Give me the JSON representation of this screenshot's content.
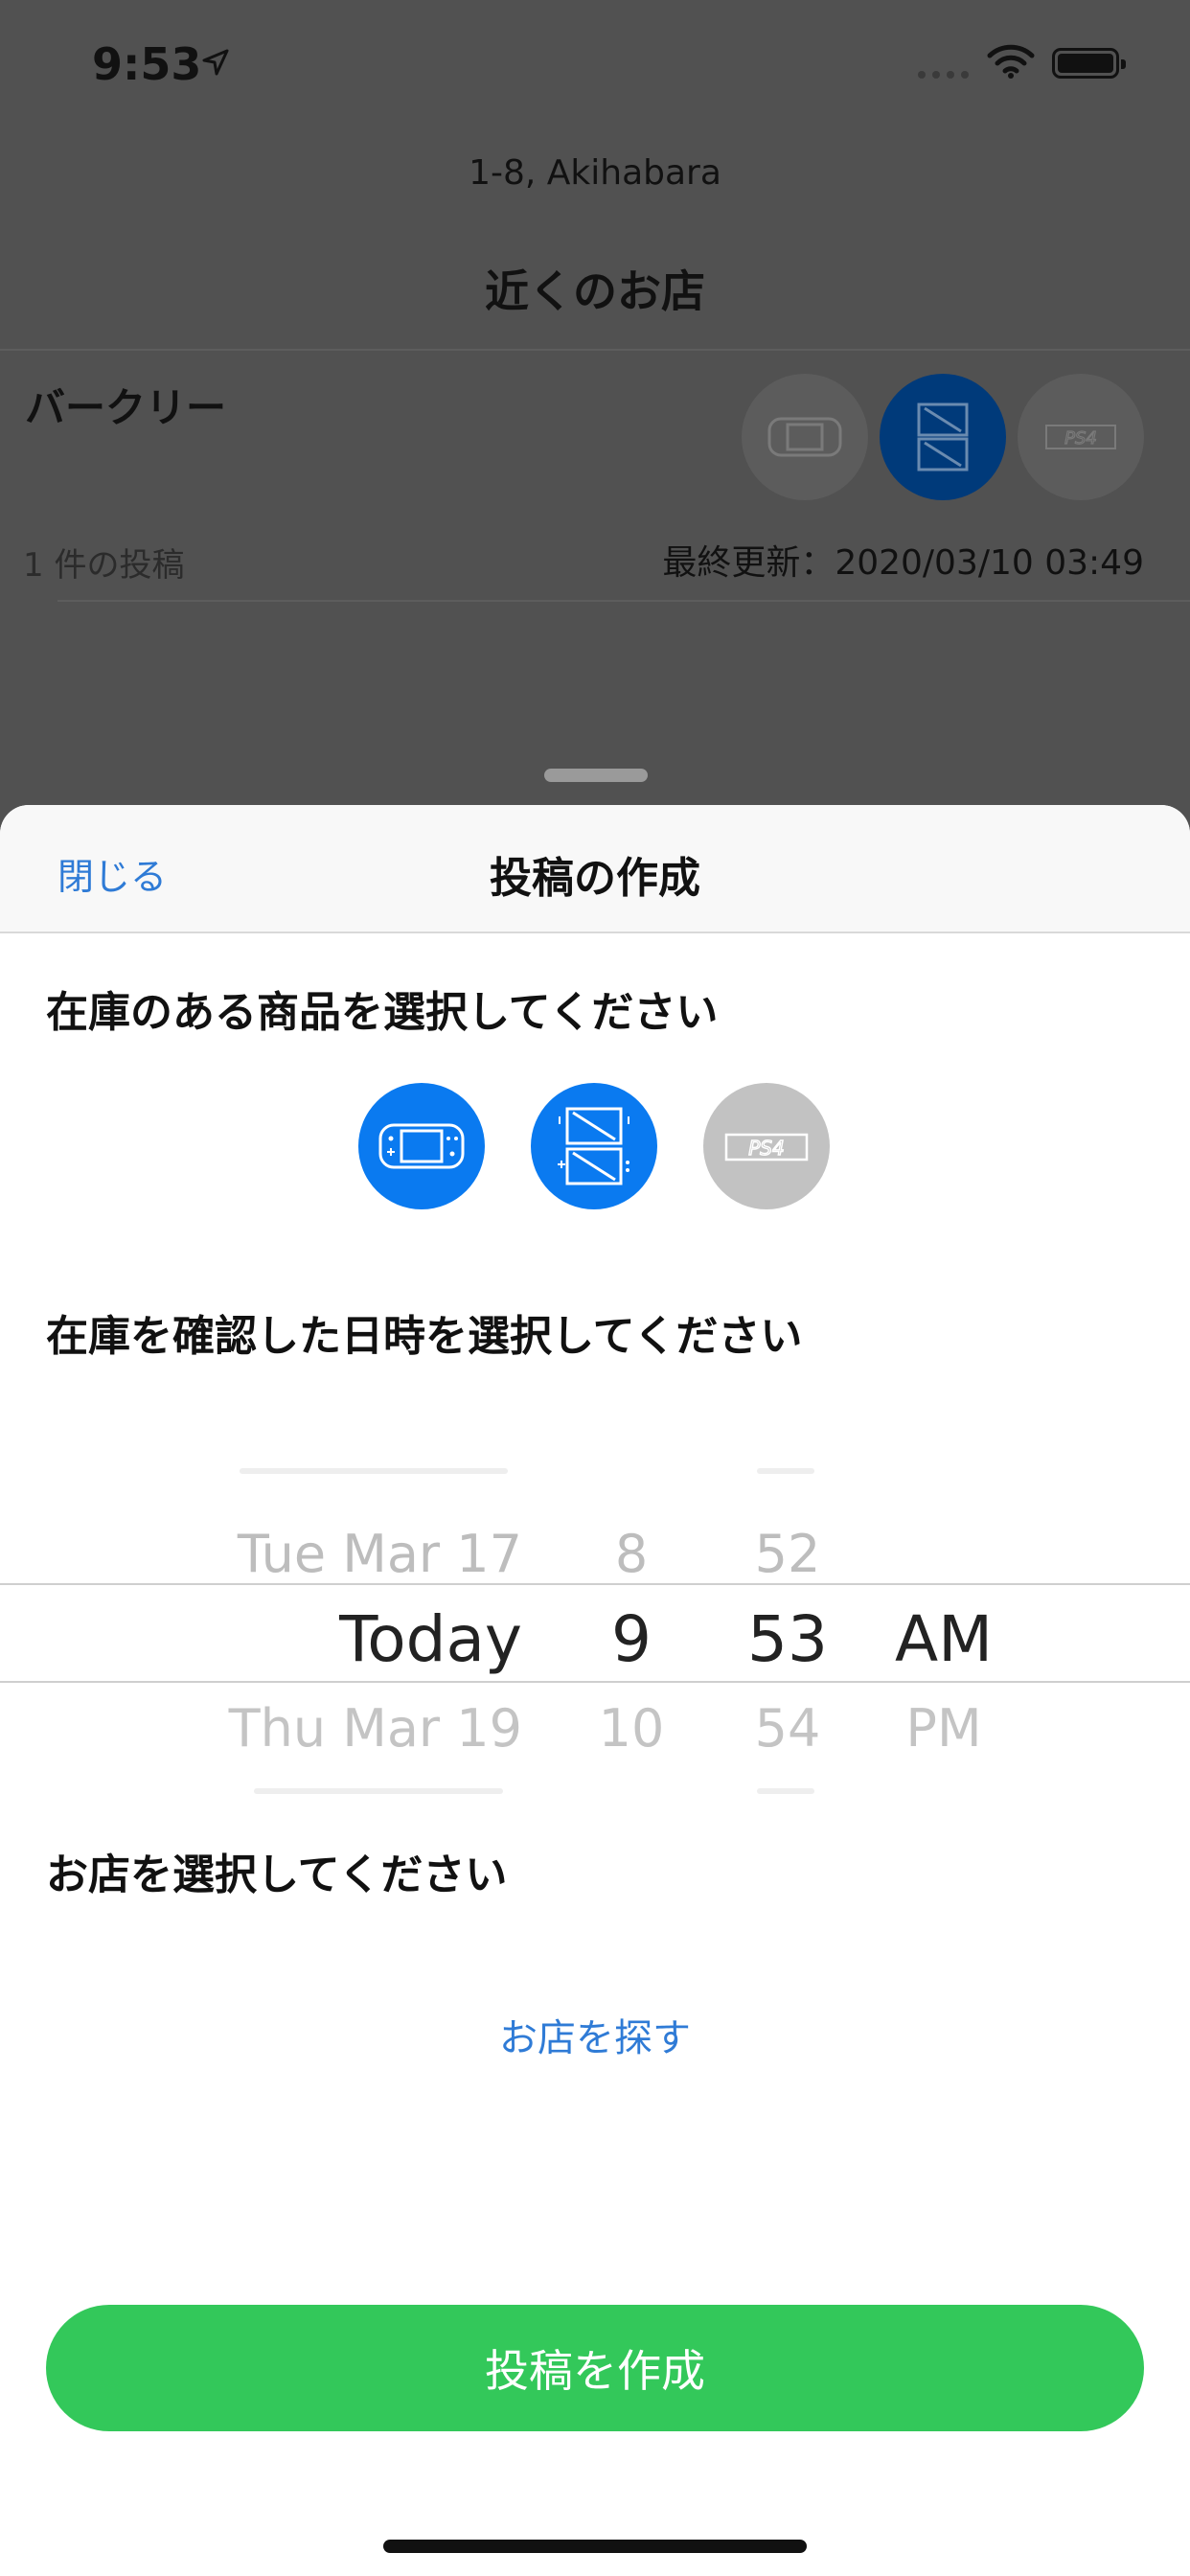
{
  "status_bar": {
    "time": "9:53"
  },
  "background": {
    "address": "1-8, Akihabara",
    "title": "近くのお店",
    "shop": {
      "name": "バークリー",
      "post_count": "1 件の投稿",
      "last_updated": "最終更新：2020/03/10 03:49",
      "icons": [
        "switch-icon",
        "ds-icon",
        "ps4-icon"
      ]
    }
  },
  "sheet": {
    "close_label": "閉じる",
    "title": "投稿の作成",
    "products_label": "在庫のある商品を選択してください",
    "products": [
      {
        "icon": "switch-icon",
        "selected": true
      },
      {
        "icon": "ds-icon",
        "selected": true
      },
      {
        "icon": "ps4-icon",
        "selected": false
      }
    ],
    "datetime_label": "在庫を確認した日時を選択してください",
    "picker": {
      "date": {
        "prev": "Tue Mar 17",
        "current": "Today",
        "next": "Thu Mar 19"
      },
      "hour": {
        "prev": "8",
        "current": "9",
        "next": "10"
      },
      "minute": {
        "prev": "52",
        "current": "53",
        "next": "54"
      },
      "ampm": {
        "current": "AM",
        "next": "PM"
      }
    },
    "shop_label": "お店を選択してください",
    "find_shop_label": "お店を探す",
    "create_label": "投稿を作成"
  },
  "colors": {
    "accent": "#2f7bd6",
    "selected": "#0a7af0",
    "unselected": "#c2c2c2",
    "create": "#33c85a"
  }
}
